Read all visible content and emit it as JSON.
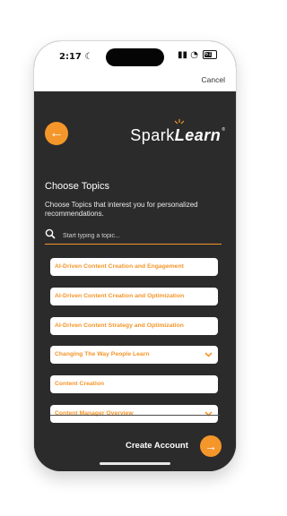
{
  "status_bar": {
    "time": "2:17",
    "battery": "61"
  },
  "header": {
    "cancel_label": "Cancel"
  },
  "brand": {
    "logo_primary": "Spark",
    "logo_secondary": "Learn",
    "trademark": "®"
  },
  "page": {
    "title": "Choose Topics",
    "subtitle": "Choose Topics that interest you for personalized recommendations."
  },
  "search": {
    "placeholder": "Start typing a topic..."
  },
  "topics": [
    {
      "label": "AI-Driven Content Creation and Engagement"
    },
    {
      "label": "AI-Driven Content Creation and Optimization"
    },
    {
      "label": "AI-Driven Content Strategy and Optimization"
    },
    {
      "label": "Changing The Way People Learn"
    },
    {
      "label": "Content Creation"
    },
    {
      "label": "Content Manager Overview"
    }
  ],
  "footer": {
    "create_label": "Create Account"
  },
  "colors": {
    "accent": "#f4962a",
    "background": "#2b2b2b"
  }
}
